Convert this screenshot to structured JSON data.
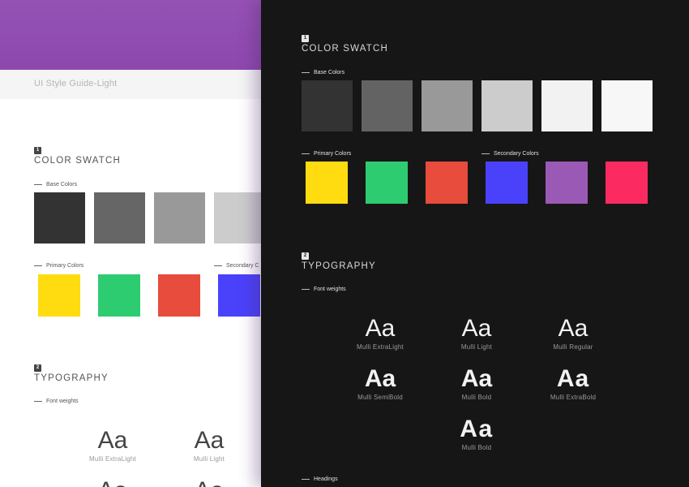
{
  "light": {
    "title": "UI Style Guide-Light",
    "color_section": {
      "number": "1",
      "title": "COLOR SWATCH"
    },
    "base_label": "Base Colors",
    "base_colors": [
      "#333333",
      "#666666",
      "#999999",
      "#cccccc"
    ],
    "primary_label": "Primary Colors",
    "primary_colors": [
      "#ffdc0f",
      "#2ecc71",
      "#e74c3c",
      "#4a42fb"
    ],
    "secondary_label": "Secondary C",
    "typography_section": {
      "number": "2",
      "title": "TYPOGRAPHY"
    },
    "font_weights_label": "Font weights",
    "specimens": [
      {
        "glyph": "Aa",
        "name": "Mulli ExtraLight"
      },
      {
        "glyph": "Aa",
        "name": "Mulli Light"
      }
    ],
    "partial_glyphs": [
      "Aa",
      "Aa"
    ]
  },
  "dark": {
    "color_section": {
      "number": "1",
      "title": "COLOR SWATCH"
    },
    "base_label": "Base Colors",
    "base_colors": [
      "#333333",
      "#636363",
      "#999999",
      "#cccccc",
      "#f2f2f2",
      "#f7f7f7"
    ],
    "primary_label": "Primary Colors",
    "primary_colors": [
      "#ffdc0f",
      "#2ecc71",
      "#e74c3c"
    ],
    "secondary_label": "Secondary Colors",
    "secondary_colors": [
      "#4a42fb",
      "#9b59b6",
      "#fb2b62"
    ],
    "typography_section": {
      "number": "2",
      "title": "TYPOGRAPHY"
    },
    "font_weights_label": "Font weights",
    "specimens": [
      {
        "glyph": "Aa",
        "name": "Mulli ExtraLight"
      },
      {
        "glyph": "Aa",
        "name": "Mulli Light"
      },
      {
        "glyph": "Aa",
        "name": "Mulli Regular"
      },
      {
        "glyph": "Aa",
        "name": "Mulli SemiBold"
      },
      {
        "glyph": "Aa",
        "name": "Mulli Bold"
      },
      {
        "glyph": "Aa",
        "name": "Mulli ExtraBold"
      },
      {
        "glyph": "Aa",
        "name": "Mulli Bold"
      }
    ],
    "headings_label": "Headings"
  },
  "colors": {
    "header_purple": "#9552b4",
    "dark_bg": "#161616"
  }
}
